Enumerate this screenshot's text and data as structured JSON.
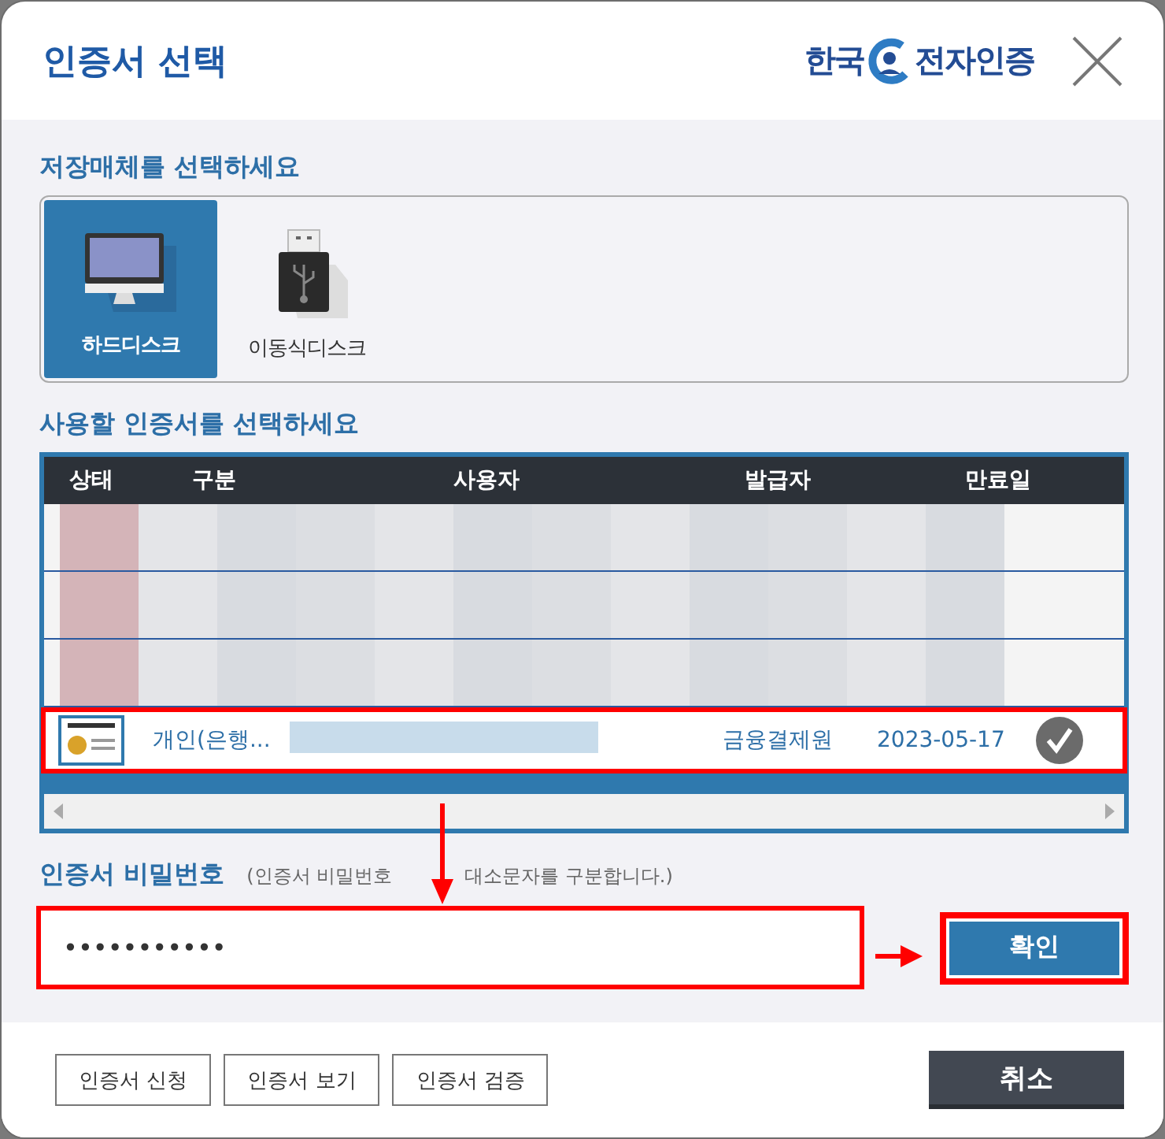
{
  "window": {
    "title": "인증서 선택",
    "logo": [
      "한국",
      "전자인증"
    ]
  },
  "storage": {
    "label": "저장매체를 선택하세요",
    "media": [
      {
        "label": "하드디스크",
        "kind": "computer",
        "selected": true
      },
      {
        "label": "이동식디스크",
        "kind": "usb",
        "selected": false
      }
    ]
  },
  "certificates": {
    "label": "사용할 인증서를 선택하세요",
    "columns": [
      "상태",
      "구분",
      "사용자",
      "발급자",
      "만료일"
    ],
    "rows": [
      {
        "kind": "redacted",
        "selected": false
      },
      {
        "kind": "redacted",
        "selected": false
      },
      {
        "kind": "redacted",
        "selected": false
      },
      {
        "kind": "certificate",
        "selected": true,
        "highlighted": true,
        "type": "개인(은행...",
        "issuer": "금융결제원",
        "expires": "2023-05-17"
      }
    ]
  },
  "password": {
    "label": "인증서 비밀번호",
    "hint": [
      "(인증서 비밀번호",
      "대소문자를 구분합니다.)"
    ],
    "value": "•••••••••••",
    "highlighted": true
  },
  "confirm": {
    "label": "확인",
    "highlighted": true
  },
  "footer": {
    "buttons": [
      "인증서 신청",
      "인증서 보기",
      "인증서 검증"
    ],
    "cancel": "취소"
  }
}
